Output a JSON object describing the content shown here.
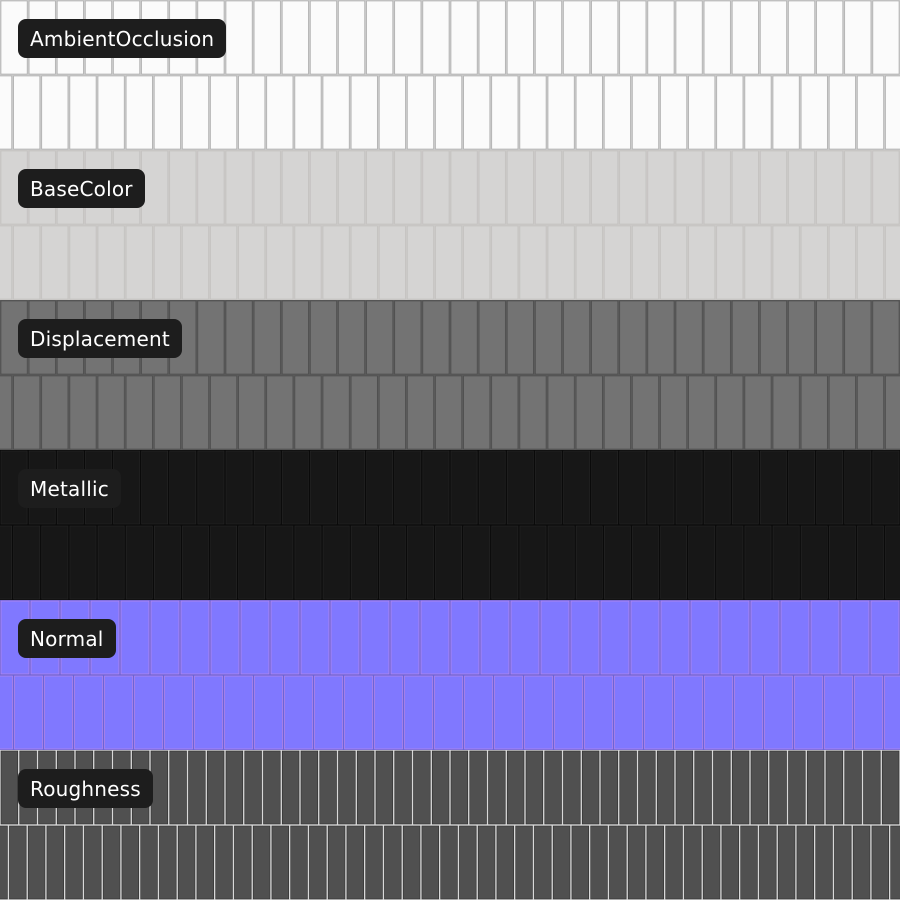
{
  "maps": [
    {
      "label": "AmbientOcclusion",
      "icon": "ambient-occlusion-texture",
      "colors": {
        "base": "#ffffff",
        "tile": "#fbfbfb",
        "grout": "#c9c9c9",
        "line": "#a9a9a9"
      },
      "tiles_per_row": 32
    },
    {
      "label": "BaseColor",
      "icon": "base-color-texture",
      "colors": {
        "base": "#d7d6d5",
        "tile": "#d5d4d3",
        "grout": "#cbc9c7",
        "line": "#c2c0be"
      },
      "tiles_per_row": 32
    },
    {
      "label": "Displacement",
      "icon": "displacement-texture",
      "colors": {
        "base": "#6d6d6d",
        "tile": "#737373",
        "grout": "#5a5a5a",
        "line": "#4b4b4b"
      },
      "tiles_per_row": 32
    },
    {
      "label": "Metallic",
      "icon": "metallic-texture",
      "colors": {
        "base": "#141414",
        "tile": "#171717",
        "grout": "#0a0a0a",
        "line": "#262626"
      },
      "tiles_per_row": 32
    },
    {
      "label": "Normal",
      "icon": "normal-map-texture",
      "colors": {
        "base": "#7a73f6",
        "tile": "#8078ff",
        "grout": "#6a64d8",
        "line": "#c48be8"
      },
      "tiles_per_row": 30
    },
    {
      "label": "Roughness",
      "icon": "roughness-texture",
      "colors": {
        "base": "#4a4a4a",
        "tile": "#505050",
        "grout": "#d9d9d9",
        "line": "#2e2e2e"
      },
      "tiles_per_row": 48
    }
  ]
}
